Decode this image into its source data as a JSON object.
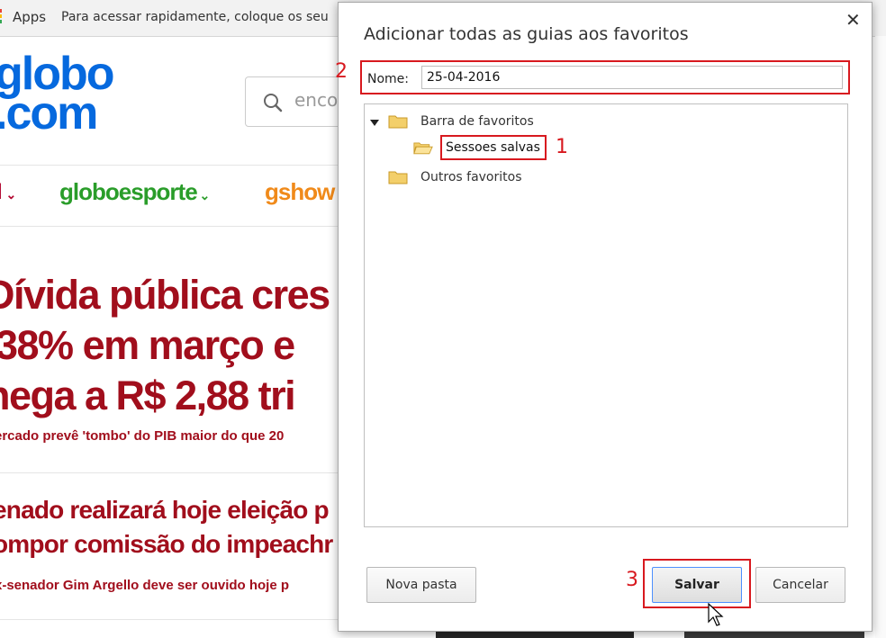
{
  "bookmarks_bar": {
    "apps_label": "Apps",
    "hint": "Para acessar rapidamente, coloque os seu"
  },
  "background_page": {
    "logo_line1": "globo",
    "logo_line2": ".com",
    "search_placeholder": "enco",
    "nav": {
      "g1": "l",
      "esporte": "globoesporte",
      "gshow": "gshow"
    },
    "headline_lines": [
      "Dívida pública cres",
      ",38% em março e",
      "hega a R$ 2,88 tri"
    ],
    "headline_sub": "ercado prevê 'tombo' do PIB maior do que 20",
    "story2_lines": [
      "enado realizará hoje eleição p",
      "ompor comissão do impeachr"
    ],
    "story2_sub": "x-senador Gim Argello deve ser ouvido hoje p"
  },
  "dialog": {
    "title": "Adicionar todas as guias aos favoritos",
    "name_label": "Nome:",
    "name_value": "25-04-2016",
    "tree": {
      "root": "Barra de favoritos",
      "child": "Sessoes salvas",
      "other": "Outros favoritos"
    },
    "buttons": {
      "new_folder": "Nova pasta",
      "save": "Salvar",
      "cancel": "Cancelar"
    },
    "annotations": {
      "a1": "1",
      "a2": "2",
      "a3": "3"
    }
  },
  "colors": {
    "annotation_red": "#d8191f",
    "globo_blue": "#0669de",
    "headline_red": "#a10e1c"
  }
}
